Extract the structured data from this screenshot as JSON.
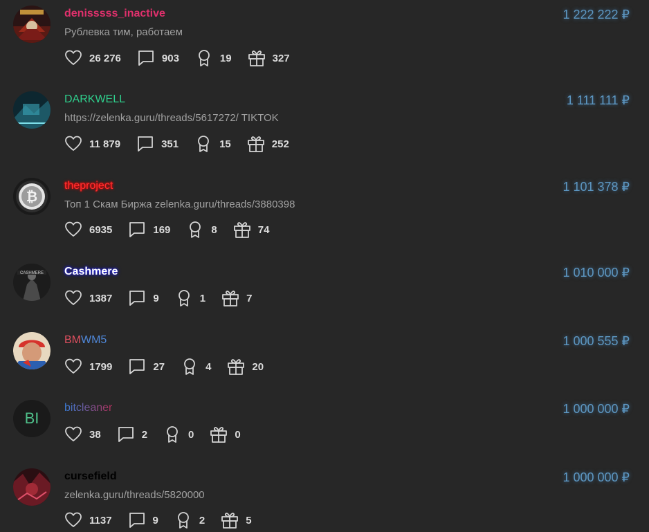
{
  "users": [
    {
      "username": "denisssss_inactive",
      "status": "Рублевка тим, работаем",
      "amount": "1 222 222 ₽",
      "likes": "26 276",
      "messages": "903",
      "trophies": "19",
      "gifts": "327",
      "avatar_icon": "avatar-image"
    },
    {
      "username": "DARKWELL",
      "status": "https://zelenka.guru/threads/5617272/ TIKTOK",
      "amount": "1 111 111 ₽",
      "likes": "11 879",
      "messages": "351",
      "trophies": "15",
      "gifts": "252",
      "avatar_icon": "avatar-image"
    },
    {
      "username": "theproject",
      "status": "Топ 1 Скам Биржа zelenka.guru/threads/3880398",
      "amount": "1 101 378 ₽",
      "likes": "6935",
      "messages": "169",
      "trophies": "8",
      "gifts": "74",
      "avatar_icon": "bitcoin-icon"
    },
    {
      "username": "Cashmere",
      "status": "",
      "amount": "1 010 000 ₽",
      "likes": "1387",
      "messages": "9",
      "trophies": "1",
      "gifts": "7",
      "avatar_icon": "avatar-image"
    },
    {
      "username_parts": [
        "BM",
        "WM5"
      ],
      "status": "",
      "amount": "1 000 555 ₽",
      "likes": "1799",
      "messages": "27",
      "trophies": "4",
      "gifts": "20",
      "avatar_icon": "avatar-image"
    },
    {
      "username": "bitcleaner",
      "avatar_initials": "BI",
      "status": "",
      "amount": "1 000 000 ₽",
      "likes": "38",
      "messages": "2",
      "trophies": "0",
      "gifts": "0",
      "avatar_icon": "initials-avatar"
    },
    {
      "username": "cursefield",
      "status": "zelenka.guru/threads/5820000",
      "amount": "1 000 000 ₽",
      "likes": "1137",
      "messages": "9",
      "trophies": "2",
      "gifts": "5",
      "avatar_icon": "avatar-image"
    }
  ],
  "colors": {
    "background": "#272727",
    "amount": "#5d97c2",
    "denisssss_inactive": "#e0306c",
    "DARKWELL": "#2fcf8d",
    "theproject": "#ff3030",
    "Cashmere": "#ffffff",
    "BM": "#e05060",
    "WM5": "#4f87d8",
    "cursefield": "#000000"
  }
}
